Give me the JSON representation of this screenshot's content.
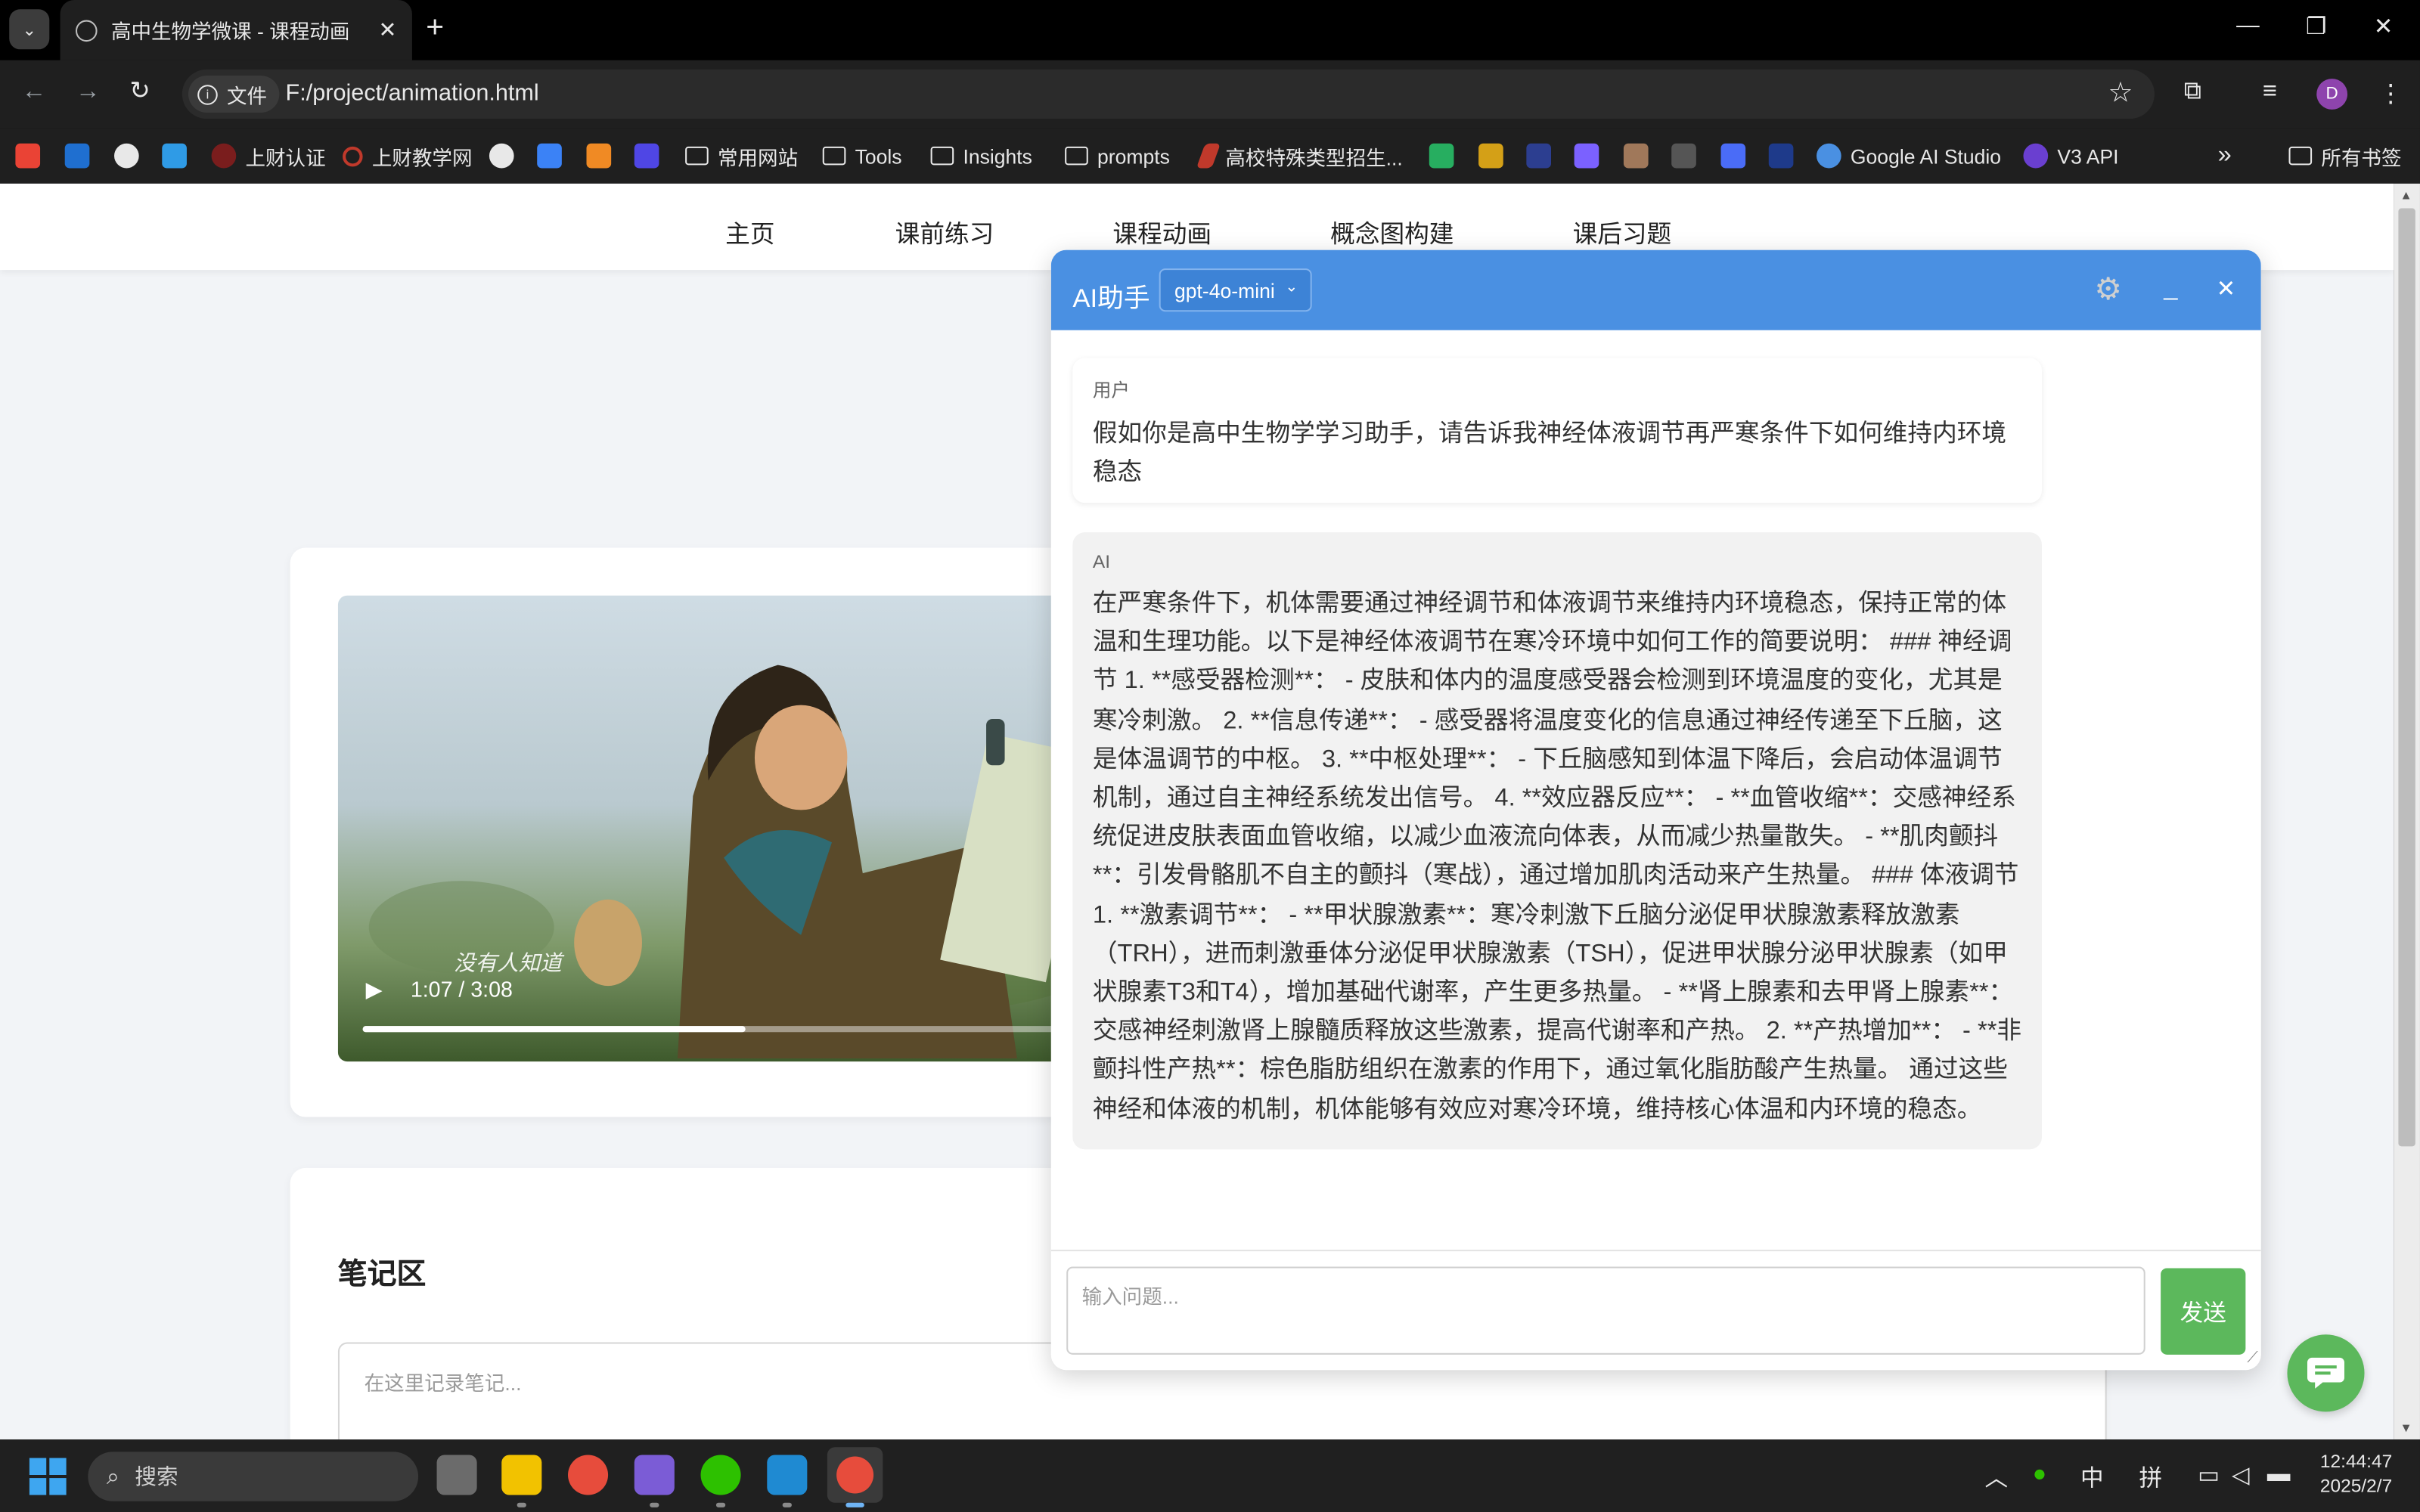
{
  "browser": {
    "tab_title": "高中生物学微课 - 课程动画",
    "address_chip": "文件",
    "url": "F:/project/animation.html",
    "avatar_letter": "D",
    "bookmarks": [
      {
        "label": "上财认证",
        "icon": "shield-icon",
        "color": "#c0392b"
      },
      {
        "label": "上财教学网",
        "icon": "circle-icon",
        "color": "#c0392b"
      },
      {
        "label": "常用网站",
        "icon": "folder-icon"
      },
      {
        "label": "Tools",
        "icon": "folder-icon"
      },
      {
        "label": "Insights",
        "icon": "folder-icon"
      },
      {
        "label": "prompts",
        "icon": "folder-icon"
      },
      {
        "label": "高校特殊类型招生...",
        "icon": "quill-icon",
        "color": "#c0392b"
      },
      {
        "label": "Google AI Studio",
        "icon": "sparkle-icon",
        "color": "#4a90e2"
      },
      {
        "label": "V3 API",
        "icon": "v-icon",
        "color": "#6a3fd0"
      }
    ],
    "all_bookmarks": "所有书签"
  },
  "nav": {
    "items": [
      "主页",
      "课前练习",
      "课程动画",
      "概念图构建",
      "课后习题"
    ]
  },
  "video": {
    "subtitle": "没有人知道",
    "time": "1:07 / 3:08",
    "progress": 0.55
  },
  "notes": {
    "title": "笔记区",
    "placeholder": "在这里记录笔记..."
  },
  "ai": {
    "title": "AI助手",
    "model": "gpt-4o-mini",
    "messages": [
      {
        "role": "用户",
        "text": "假如你是高中生物学学习助手，请告诉我神经体液调节再严寒条件下如何维持内环境稳态"
      },
      {
        "role": "AI",
        "text": "在严寒条件下，机体需要通过神经调节和体液调节来维持内环境稳态，保持正常的体温和生理功能。以下是神经体液调节在寒冷环境中如何工作的简要说明： ### 神经调节 1. **感受器检测**： - 皮肤和体内的温度感受器会检测到环境温度的变化，尤其是寒冷刺激。 2. **信息传递**： - 感受器将温度变化的信息通过神经传递至下丘脑，这是体温调节的中枢。 3. **中枢处理**： - 下丘脑感知到体温下降后，会启动体温调节机制，通过自主神经系统发出信号。 4. **效应器反应**： - **血管收缩**：交感神经系统促进皮肤表面血管收缩，以减少血液流向体表，从而减少热量散失。 - **肌肉颤抖**：引发骨骼肌不自主的颤抖（寒战），通过增加肌肉活动来产生热量。 ### 体液调节 1. **激素调节**： - **甲状腺激素**：寒冷刺激下丘脑分泌促甲状腺激素释放激素（TRH），进而刺激垂体分泌促甲状腺激素（TSH），促进甲状腺分泌甲状腺素（如甲状腺素T3和T4），增加基础代谢率，产生更多热量。 - **肾上腺素和去甲肾上腺素**：交感神经刺激肾上腺髓质释放这些激素，提高代谢率和产热。 2. **产热增加**： - **非颤抖性产热**：棕色脂肪组织在激素的作用下，通过氧化脂肪酸产生热量。 通过这些神经和体液的机制，机体能够有效应对寒冷环境，维持核心体温和内环境的稳态。"
      }
    ],
    "input_placeholder": "输入问题...",
    "send_label": "发送"
  },
  "taskbar": {
    "search_label": "搜索",
    "ime_1": "中",
    "ime_2": "拼",
    "time": "12:44:47",
    "date": "2025/2/7"
  },
  "colors": {
    "ai_header": "#4a90e2",
    "send_button": "#5cb85c",
    "page_bg": "#f2f4f7"
  }
}
